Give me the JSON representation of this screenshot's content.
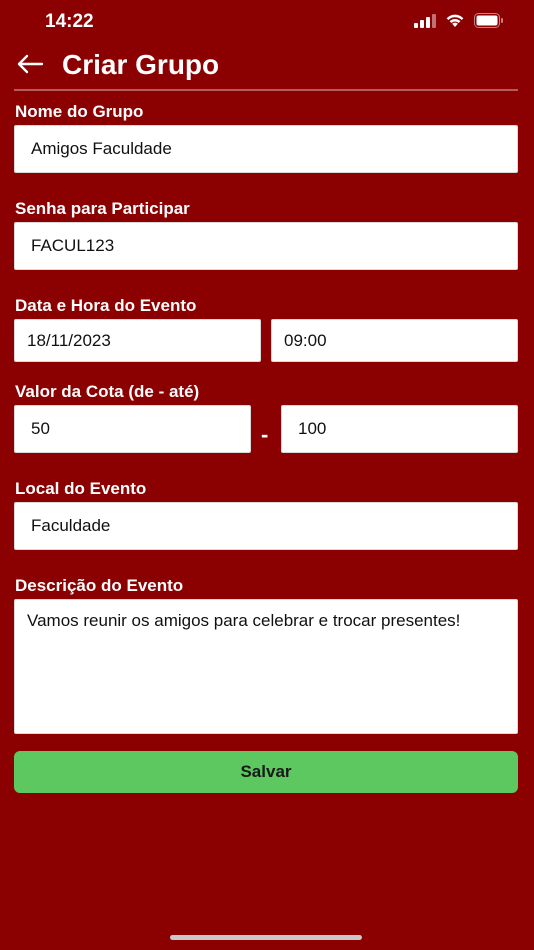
{
  "status_bar": {
    "time": "14:22"
  },
  "header": {
    "title": "Criar Grupo",
    "back_icon": "arrow-left-icon"
  },
  "form": {
    "group_name": {
      "label": "Nome do Grupo",
      "value": "Amigos Faculdade"
    },
    "password": {
      "label": "Senha para Participar",
      "value": "FACUL123"
    },
    "event_datetime": {
      "label": "Data e Hora do Evento",
      "date": "18/11/2023",
      "time": "09:00"
    },
    "quota": {
      "label": "Valor da Cota (de - até)",
      "min": "50",
      "separator": "-",
      "max": "100"
    },
    "location": {
      "label": "Local do Evento",
      "value": "Faculdade"
    },
    "description": {
      "label": "Descrição do Evento",
      "value": "Vamos reunir os amigos para celebrar e trocar presentes!"
    }
  },
  "actions": {
    "save_label": "Salvar"
  },
  "colors": {
    "background": "#8b0000",
    "save_button": "#5cc85f",
    "input_bg": "#ffffff"
  }
}
